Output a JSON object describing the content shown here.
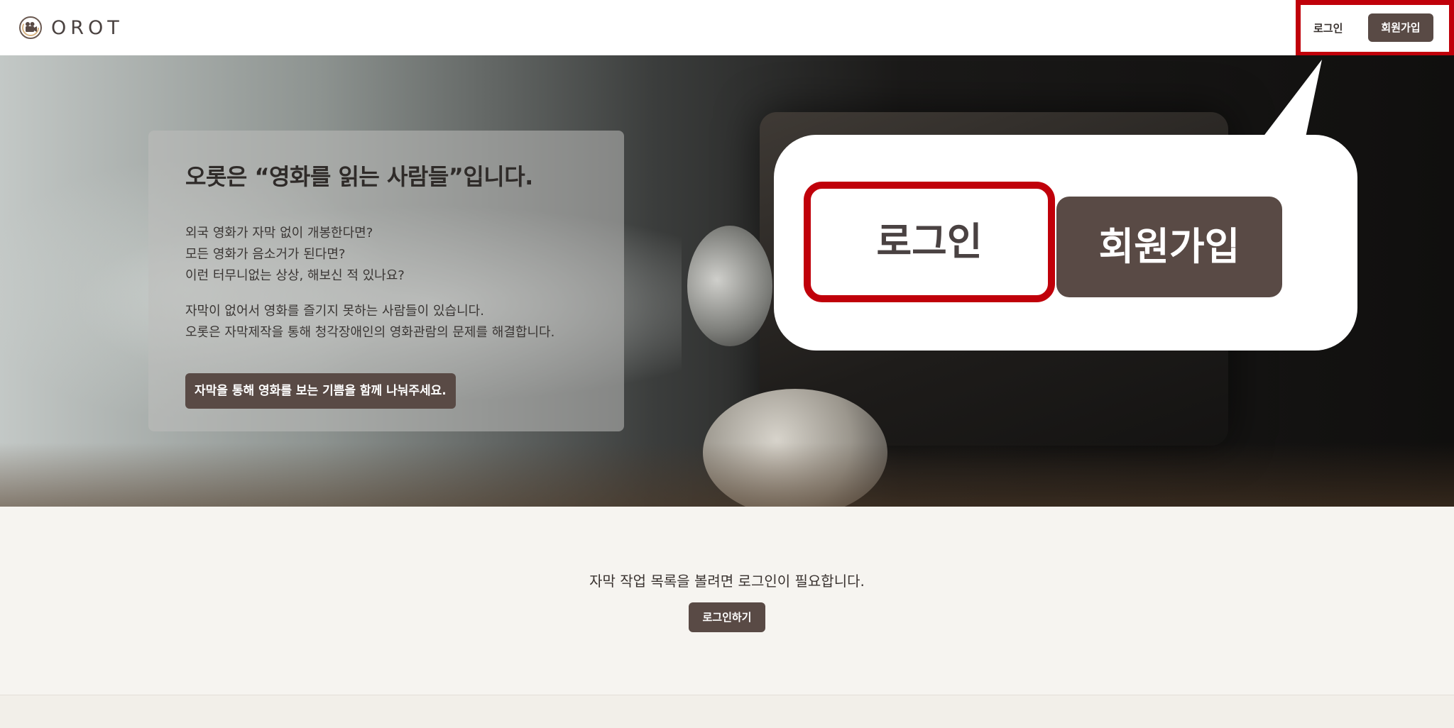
{
  "brand": {
    "name": "OROT",
    "logo_icon": "film-camera-icon"
  },
  "nav": {
    "login_label": "로그인",
    "signup_label": "회원가입"
  },
  "hero": {
    "title": "오롯은 “영화를 읽는 사람들”입니다.",
    "paragraph1": [
      "외국 영화가 자막 없이 개봉한다면?",
      "모든 영화가 음소거가 된다면?",
      "이런 터무니없는 상상, 해보신 적 있나요?"
    ],
    "paragraph2": [
      "자막이 없어서 영화를 즐기지 못하는 사람들이 있습니다.",
      "오롯은 자막제작을 통해 청각장애인의 영화관람의 문제를 해결합니다."
    ],
    "cta_label": "자막을 통해 영화를 보는 기쁨을 함께 나눠주세요."
  },
  "callout": {
    "login_label": "로그인",
    "signup_label": "회원가입",
    "highlight_color": "#c0000a"
  },
  "notice": {
    "message": "자막 작업 목록을 볼려면 로그인이 필요합니다.",
    "button_label": "로그인하기"
  },
  "colors": {
    "primary_button": "#594a45",
    "highlight": "#c0000a",
    "page_bg": "#f6f4f0"
  }
}
